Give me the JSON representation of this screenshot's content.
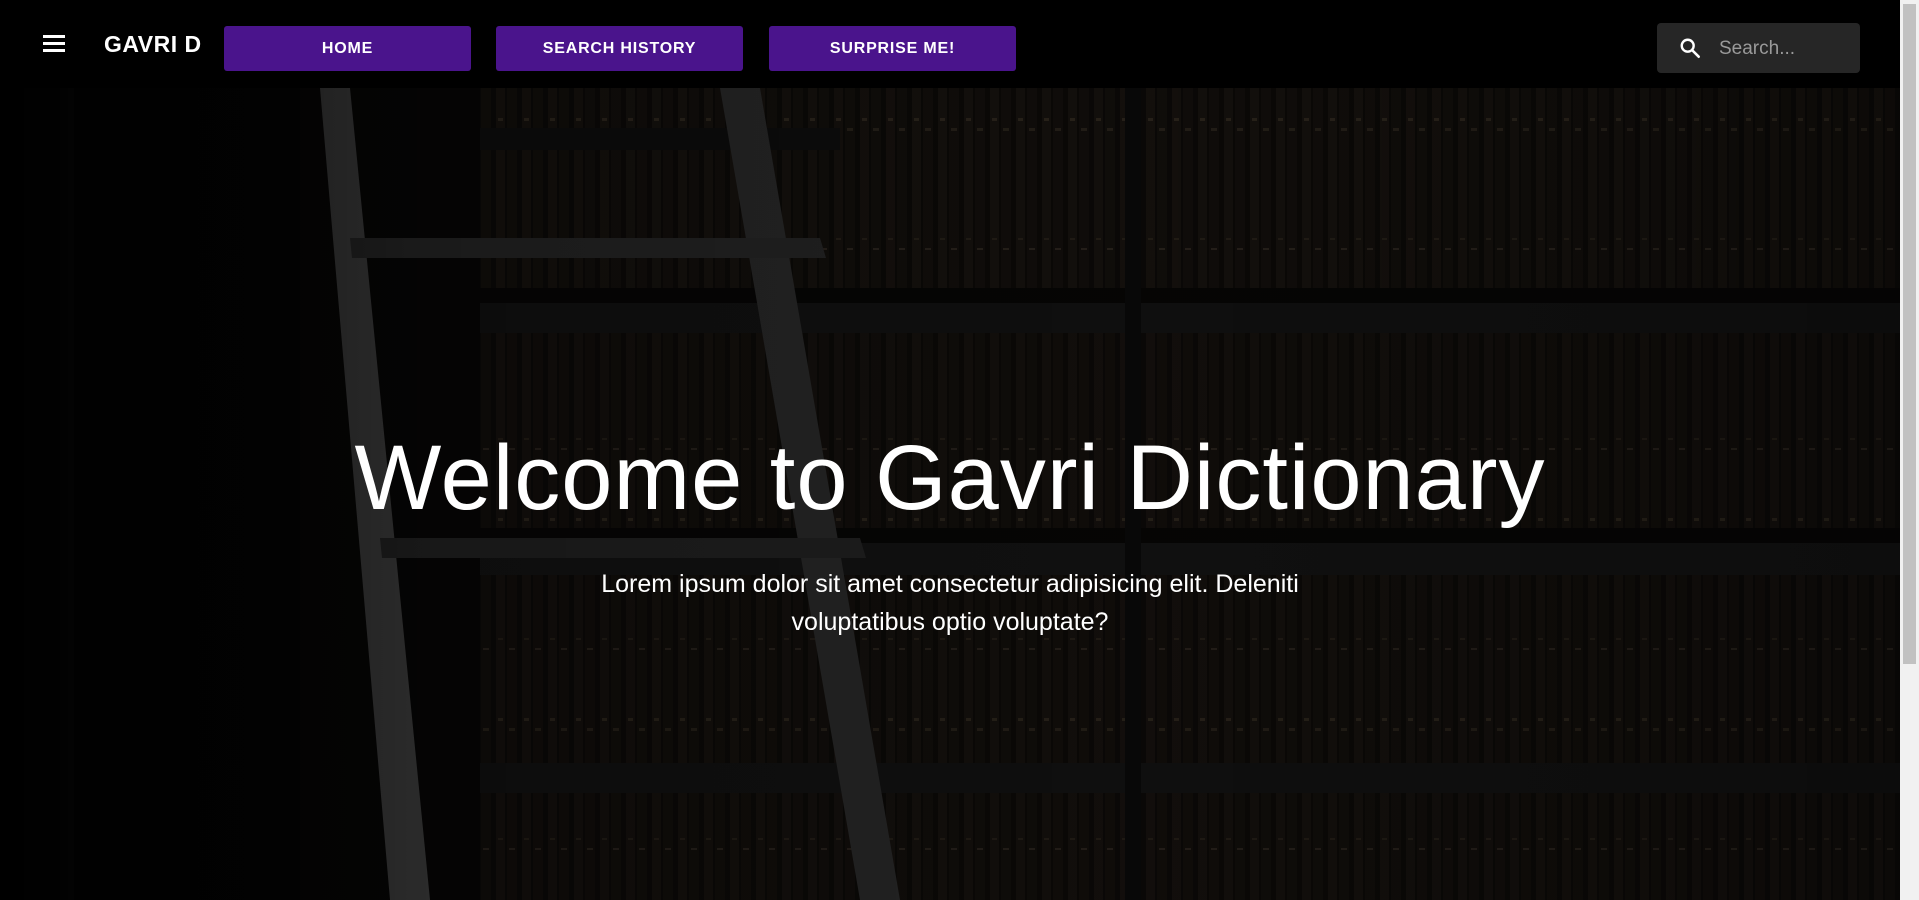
{
  "header": {
    "brand": "GAVRI D",
    "nav": {
      "home": "HOME",
      "search_history": "SEARCH HISTORY",
      "surprise": "SURPRISE ME!"
    },
    "search": {
      "placeholder": "Search..."
    }
  },
  "hero": {
    "title": "Welcome to Gavri Dictionary",
    "text": "Lorem ipsum dolor sit amet consectetur adipisicing elit. Deleniti voluptatibus optio voluptate?"
  },
  "colors": {
    "nav_button": "#4a148c",
    "appbar": "#000000",
    "search_bg": "#262626"
  },
  "icons": {
    "menu": "menu-icon",
    "search": "search-icon"
  }
}
